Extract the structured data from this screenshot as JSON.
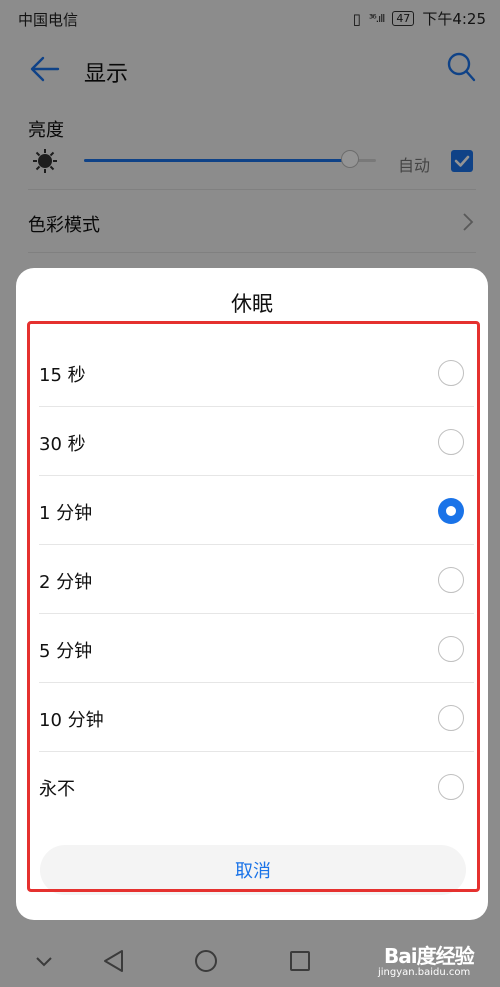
{
  "status_bar": {
    "carrier": "中国电信",
    "signal": "³⁶.ıll",
    "battery": "47",
    "time": "下午4:25"
  },
  "header": {
    "title": "显示"
  },
  "brightness": {
    "label": "亮度",
    "level": 0.91,
    "auto_label": "自动",
    "auto_checked": true
  },
  "color_mode": {
    "label": "色彩模式"
  },
  "dialog": {
    "title": "休眠",
    "options": [
      {
        "label": "15 秒",
        "selected": false
      },
      {
        "label": "30 秒",
        "selected": false
      },
      {
        "label": "1 分钟",
        "selected": true
      },
      {
        "label": "2 分钟",
        "selected": false
      },
      {
        "label": "5 分钟",
        "selected": false
      },
      {
        "label": "10 分钟",
        "selected": false
      },
      {
        "label": "永不",
        "selected": false
      }
    ],
    "cancel_label": "取消"
  },
  "watermark": {
    "brand": "Bai度经验",
    "sub": "jingyan.baidu.com"
  },
  "colors": {
    "accent": "#1a73e8",
    "highlight": "#e5312f"
  }
}
